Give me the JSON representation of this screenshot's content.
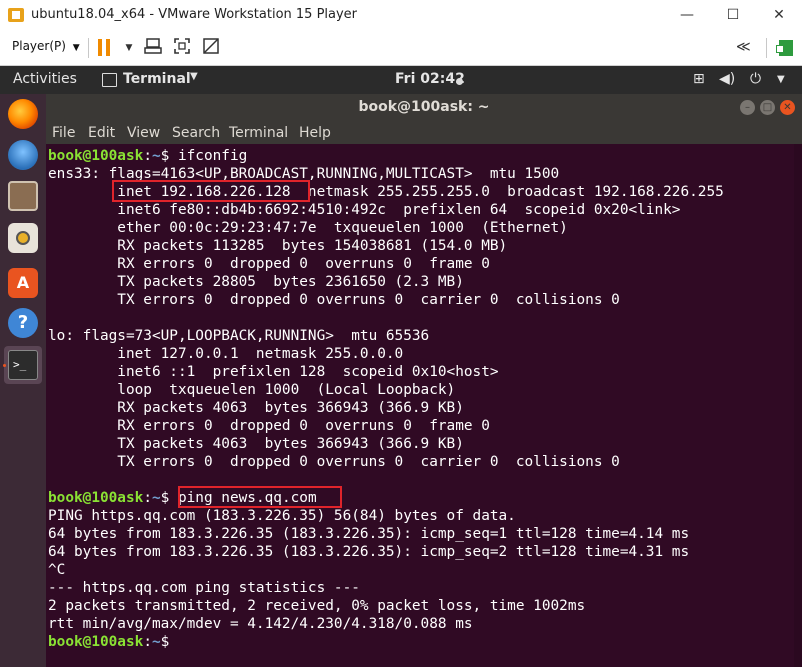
{
  "vmware": {
    "title": "ubuntu18.04_x64 - VMware Workstation 15 Player",
    "player_menu": "Player(P)",
    "player_caret": "▼",
    "minimize": "—",
    "maximize": "☐",
    "close": "✕",
    "back_label": "≪",
    "icons": [
      "pause-icon",
      "send-keys-icon",
      "fullscreen-icon",
      "unity-icon",
      "library-icon"
    ]
  },
  "ubuntu_panel": {
    "activities": "Activities",
    "app_name": "Terminal",
    "app_caret": "▼",
    "clock": "Fri 02:42",
    "network_icon": "⊞",
    "volume_icon": "◀)",
    "power_icon": "⏻",
    "caret": "▼"
  },
  "dock": {
    "items": [
      "firefox-icon",
      "thunderbird-icon",
      "files-icon",
      "rhythmbox-icon",
      "software-icon",
      "help-icon",
      "terminal-icon"
    ],
    "colors": {
      "firefox": "#e66000",
      "thunderbird": "#2a6fb8",
      "files": "#8a6d52",
      "rhythmbox": "#e8b12a",
      "software": "#e95420",
      "help": "#3f86d6"
    }
  },
  "terminal": {
    "title": "book@100ask: ~",
    "menu": [
      "File",
      "Edit",
      "View",
      "Search",
      "Terminal",
      "Help"
    ],
    "prompt_user": "book@100ask",
    "prompt_sep": ":",
    "prompt_path": "~",
    "prompt_end": "$ ",
    "commands": {
      "ifconfig": "ifconfig",
      "ping": "ping news.qq.com",
      "last": ""
    },
    "output": {
      "l1": "ens33: flags=4163<UP,BROADCAST,RUNNING,MULTICAST>  mtu 1500",
      "l2": "        inet 192.168.226.128  netmask 255.255.255.0  broadcast 192.168.226.255",
      "l3": "        inet6 fe80::db4b:6692:4510:492c  prefixlen 64  scopeid 0x20<link>",
      "l4": "        ether 00:0c:29:23:47:7e  txqueuelen 1000  (Ethernet)",
      "l5": "        RX packets 113285  bytes 154038681 (154.0 MB)",
      "l6": "        RX errors 0  dropped 0  overruns 0  frame 0",
      "l7": "        TX packets 28805  bytes 2361650 (2.3 MB)",
      "l8": "        TX errors 0  dropped 0 overruns 0  carrier 0  collisions 0",
      "l9": "",
      "l10": "lo: flags=73<UP,LOOPBACK,RUNNING>  mtu 65536",
      "l11": "        inet 127.0.0.1  netmask 255.0.0.0",
      "l12": "        inet6 ::1  prefixlen 128  scopeid 0x10<host>",
      "l13": "        loop  txqueuelen 1000  (Local Loopback)",
      "l14": "        RX packets 4063  bytes 366943 (366.9 KB)",
      "l15": "        RX errors 0  dropped 0  overruns 0  frame 0",
      "l16": "        TX packets 4063  bytes 366943 (366.9 KB)",
      "l17": "        TX errors 0  dropped 0 overruns 0  carrier 0  collisions 0",
      "l18": "",
      "l20": "PING https.qq.com (183.3.226.35) 56(84) bytes of data.",
      "l21": "64 bytes from 183.3.226.35 (183.3.226.35): icmp_seq=1 ttl=128 time=4.14 ms",
      "l22": "64 bytes from 183.3.226.35 (183.3.226.35): icmp_seq=2 ttl=128 time=4.31 ms",
      "l23": "^C",
      "l24": "--- https.qq.com ping statistics ---",
      "l25": "2 packets transmitted, 2 received, 0% packet loss, time 1002ms",
      "l26": "rtt min/avg/max/mdev = 4.142/4.230/4.318/0.088 ms"
    },
    "colors": {
      "background": "#300a24",
      "prompt_user": "#8ae234",
      "prompt_path": "#729fcf",
      "highlight": "#e0242b"
    }
  }
}
